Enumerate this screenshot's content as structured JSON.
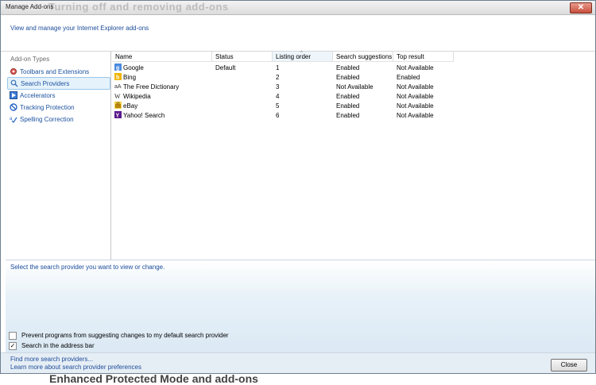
{
  "window": {
    "title": "Manage Add-ons",
    "ghost_title": "Turning off and removing add-ons",
    "close_glyph": "✕"
  },
  "header": {
    "description": "View and manage your Internet Explorer add-ons"
  },
  "sidebar": {
    "heading": "Add-on Types",
    "items": [
      {
        "label": "Toolbars and Extensions",
        "icon": "gear-icon"
      },
      {
        "label": "Search Providers",
        "icon": "search-icon"
      },
      {
        "label": "Accelerators",
        "icon": "accelerator-icon"
      },
      {
        "label": "Tracking Protection",
        "icon": "no-entry-icon"
      },
      {
        "label": "Spelling Correction",
        "icon": "spell-check-icon"
      }
    ]
  },
  "list": {
    "columns": [
      "Name",
      "Status",
      "Listing order",
      "Search suggestions",
      "Top result"
    ],
    "rows": [
      {
        "name": "Google",
        "status": "Default",
        "order": "1",
        "suggestions": "Enabled",
        "top": "Not Available",
        "icon": "google-icon"
      },
      {
        "name": "Bing",
        "status": "",
        "order": "2",
        "suggestions": "Enabled",
        "top": "Enabled",
        "icon": "bing-icon"
      },
      {
        "name": "The Free Dictionary",
        "status": "",
        "order": "3",
        "suggestions": "Not Available",
        "top": "Not Available",
        "icon": "dictionary-icon"
      },
      {
        "name": "Wikipedia",
        "status": "",
        "order": "4",
        "suggestions": "Enabled",
        "top": "Not Available",
        "icon": "wikipedia-icon"
      },
      {
        "name": "eBay",
        "status": "",
        "order": "5",
        "suggestions": "Enabled",
        "top": "Not Available",
        "icon": "ebay-icon"
      },
      {
        "name": "Yahoo! Search",
        "status": "",
        "order": "6",
        "suggestions": "Enabled",
        "top": "Not Available",
        "icon": "yahoo-icon"
      }
    ]
  },
  "details": {
    "message": "Select the search provider you want to view or change.",
    "checkbox_prevent": {
      "label": "Prevent programs from suggesting changes to my default search provider",
      "checked": false
    },
    "checkbox_address": {
      "label": "Search in the address bar",
      "checked": true
    }
  },
  "footer": {
    "link_find": "Find more search providers...",
    "link_learn": "Learn more about search provider preferences",
    "close_label": "Close"
  },
  "background_text": "Enhanced Protected Mode and add-ons"
}
